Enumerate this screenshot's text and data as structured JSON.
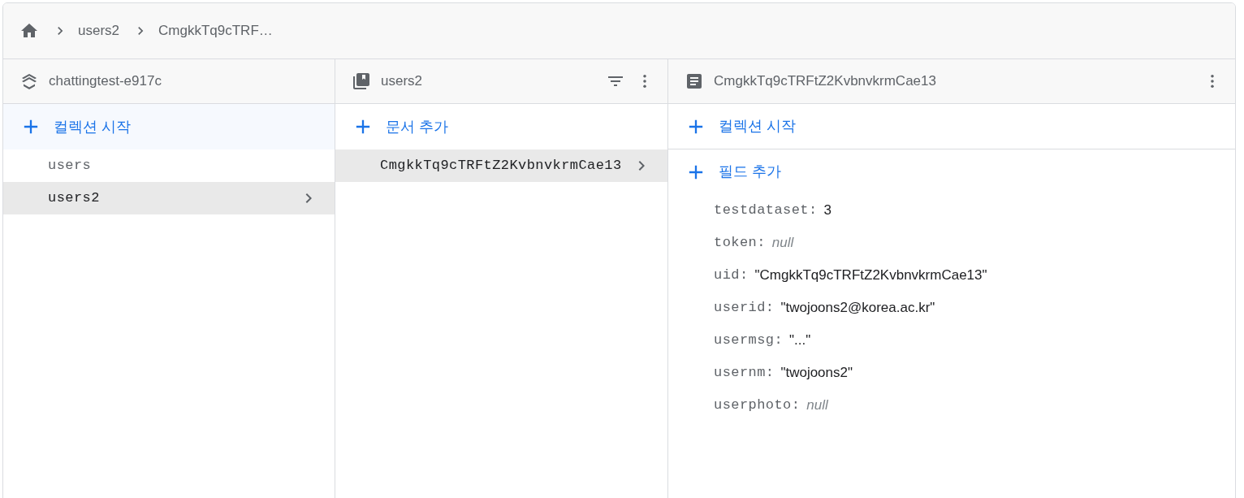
{
  "breadcrumb": [
    "users2",
    "CmgkkTq9cTRF…"
  ],
  "columns": [
    {
      "kind": "project",
      "title": "chattingtest-e917c",
      "action": "컬렉션 시작",
      "items": [
        {
          "label": "users",
          "selected": false
        },
        {
          "label": "users2",
          "selected": true
        }
      ]
    },
    {
      "kind": "collection",
      "title": "users2",
      "action": "문서 추가",
      "items": [
        {
          "label": "CmgkkTq9cTRFtZ2KvbnvkrmCae13",
          "selected": true
        }
      ]
    },
    {
      "kind": "document",
      "title": "CmgkkTq9cTRFtZ2KvbnvkrmCae13",
      "action": "컬렉션 시작",
      "field_action": "필드 추가",
      "fields": [
        {
          "key": "testdataset:",
          "value": "3",
          "kind": "number"
        },
        {
          "key": "token:",
          "value": "null",
          "kind": "null"
        },
        {
          "key": "uid:",
          "value": "\"CmgkkTq9cTRFtZ2KvbnvkrmCae13\"",
          "kind": "string"
        },
        {
          "key": "userid:",
          "value": "\"twojoons2@korea.ac.kr\"",
          "kind": "string"
        },
        {
          "key": "usermsg:",
          "value": "\"...\"",
          "kind": "string"
        },
        {
          "key": "usernm:",
          "value": "\"twojoons2\"",
          "kind": "string"
        },
        {
          "key": "userphoto:",
          "value": "null",
          "kind": "null"
        }
      ]
    }
  ]
}
